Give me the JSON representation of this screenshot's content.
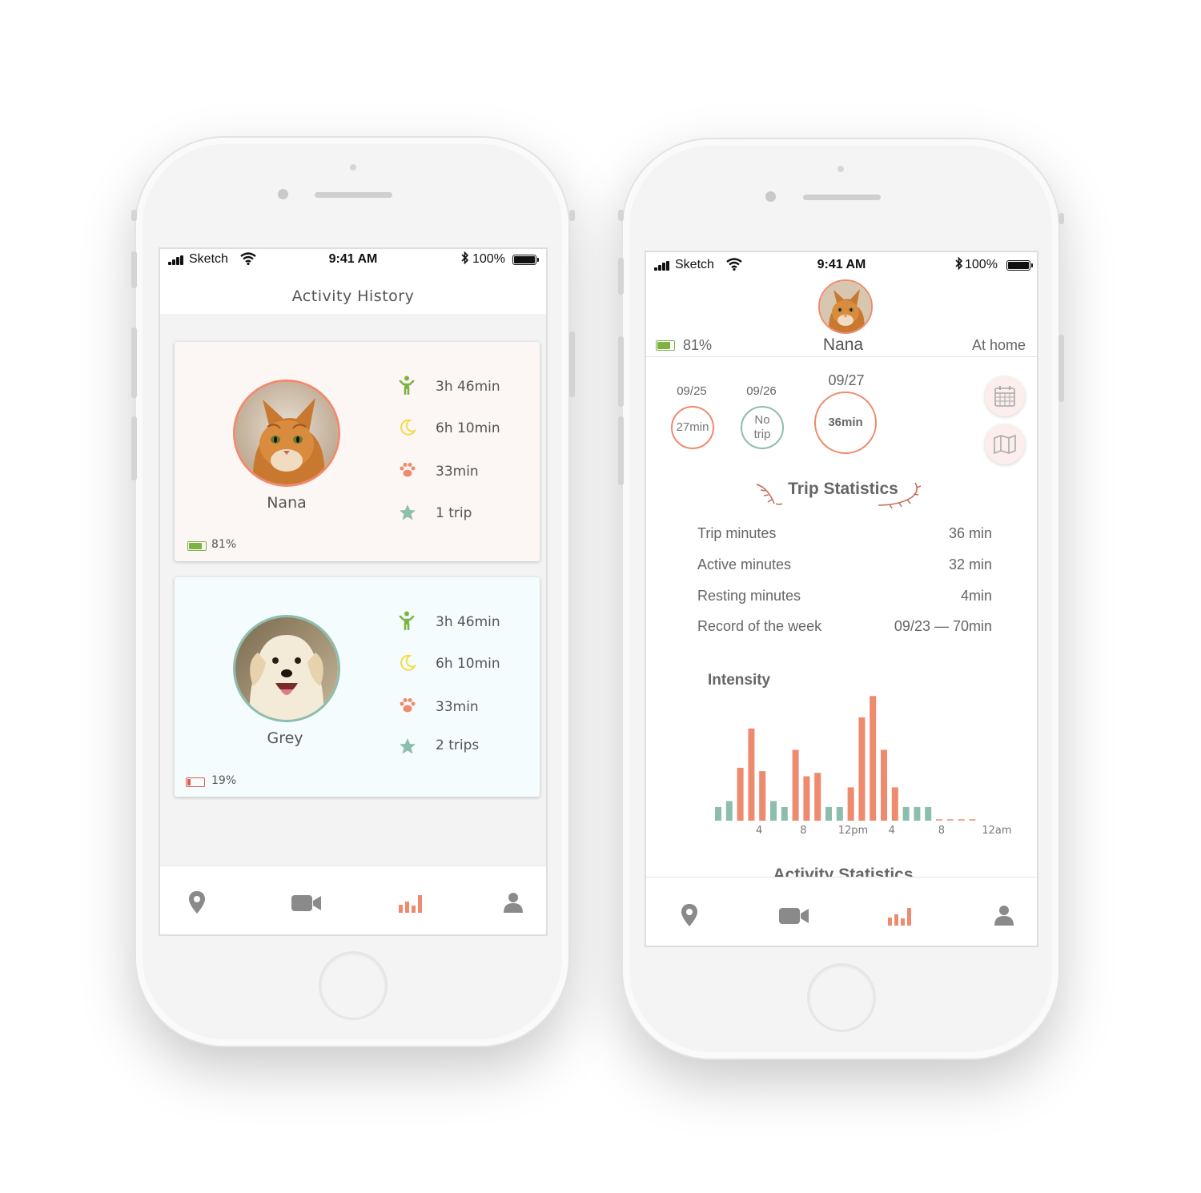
{
  "status_bar": {
    "carrier": "Sketch",
    "time": "9:41 AM",
    "battery": "100%"
  },
  "colors": {
    "coral": "#ee8a6e",
    "teal": "#8dbdad",
    "green": "#7cb342",
    "yellow": "#f2dc4a",
    "light_card_pink": "#fcf7f4",
    "light_card_blue": "#f5fcfd"
  },
  "left_screen": {
    "title": "Activity History",
    "cards": [
      {
        "name": "Nana",
        "avatar": "cat-photo",
        "battery": "81%",
        "battery_level": 0.81,
        "stats": [
          {
            "icon": "person-active-icon",
            "value": "3h 46min"
          },
          {
            "icon": "moon-icon",
            "value": "6h 10min"
          },
          {
            "icon": "paw-icon",
            "value": "33min"
          },
          {
            "icon": "star-icon",
            "value": "1 trip"
          }
        ]
      },
      {
        "name": "Grey",
        "avatar": "dog-photo",
        "battery": "19%",
        "battery_level": 0.19,
        "stats": [
          {
            "icon": "person-active-icon",
            "value": "3h 46min"
          },
          {
            "icon": "moon-icon",
            "value": "6h 10min"
          },
          {
            "icon": "paw-icon",
            "value": "33min"
          },
          {
            "icon": "star-icon",
            "value": "2 trips"
          }
        ]
      }
    ],
    "tabs": [
      "location-pin-icon",
      "video-camera-icon",
      "bar-chart-icon",
      "user-icon"
    ],
    "active_tab": 2
  },
  "right_screen": {
    "pet_name": "Nana",
    "battery": "81%",
    "battery_level": 0.81,
    "location": "At home",
    "days": [
      {
        "date": "09/25",
        "value": "27min"
      },
      {
        "date": "09/26",
        "value_line1": "No",
        "value_line2": "trip"
      },
      {
        "date": "09/27",
        "value": "36min"
      }
    ],
    "side_buttons": [
      "calendar-icon",
      "map-icon"
    ],
    "trip_statistics_title": "Trip Statistics",
    "trip_statistics": [
      {
        "label": "Trip minutes",
        "value": "36 min"
      },
      {
        "label": "Active minutes",
        "value": "32 min"
      },
      {
        "label": "Resting minutes",
        "value": "4min"
      },
      {
        "label": "Record of the week",
        "value": "09/23 — 70min"
      }
    ],
    "intensity_title": "Intensity",
    "activity_statistics_title": "Activity Statistics",
    "tabs": [
      "location-pin-icon",
      "video-camera-icon",
      "bar-chart-icon",
      "user-icon"
    ],
    "active_tab": 2
  },
  "chart_data": {
    "type": "bar",
    "title": "Intensity",
    "x_tick_labels": [
      "4",
      "8",
      "12pm",
      "4",
      "8",
      "12am"
    ],
    "x_tick_positions": [
      4,
      8,
      12.5,
      16,
      20.5,
      25.5
    ],
    "series": [
      {
        "values": [
          {
            "x": 0,
            "v": 1.6,
            "c": "teal"
          },
          {
            "x": 1,
            "v": 2.3,
            "c": "teal"
          },
          {
            "x": 2,
            "v": 6.2,
            "c": "coral"
          },
          {
            "x": 3,
            "v": 10.8,
            "c": "coral"
          },
          {
            "x": 4,
            "v": 5.8,
            "c": "coral"
          },
          {
            "x": 5,
            "v": 2.3,
            "c": "teal"
          },
          {
            "x": 6,
            "v": 1.6,
            "c": "teal"
          },
          {
            "x": 7,
            "v": 8.3,
            "c": "coral"
          },
          {
            "x": 8,
            "v": 5.2,
            "c": "coral"
          },
          {
            "x": 9,
            "v": 5.6,
            "c": "coral"
          },
          {
            "x": 10,
            "v": 1.6,
            "c": "teal"
          },
          {
            "x": 11,
            "v": 1.6,
            "c": "teal"
          },
          {
            "x": 12,
            "v": 3.9,
            "c": "coral"
          },
          {
            "x": 13,
            "v": 12.1,
            "c": "coral"
          },
          {
            "x": 14,
            "v": 14.6,
            "c": "coral"
          },
          {
            "x": 15,
            "v": 8.3,
            "c": "coral"
          },
          {
            "x": 16,
            "v": 3.9,
            "c": "coral"
          },
          {
            "x": 17,
            "v": 1.6,
            "c": "teal"
          },
          {
            "x": 18,
            "v": 1.6,
            "c": "teal"
          },
          {
            "x": 19,
            "v": 1.6,
            "c": "teal"
          },
          {
            "x": 20,
            "v": 0,
            "c": "dash"
          },
          {
            "x": 21,
            "v": 0,
            "c": "dash"
          },
          {
            "x": 22,
            "v": 0,
            "c": "dash"
          },
          {
            "x": 23,
            "v": 0,
            "c": "dash"
          }
        ]
      }
    ],
    "ylim": [
      0,
      15
    ]
  }
}
